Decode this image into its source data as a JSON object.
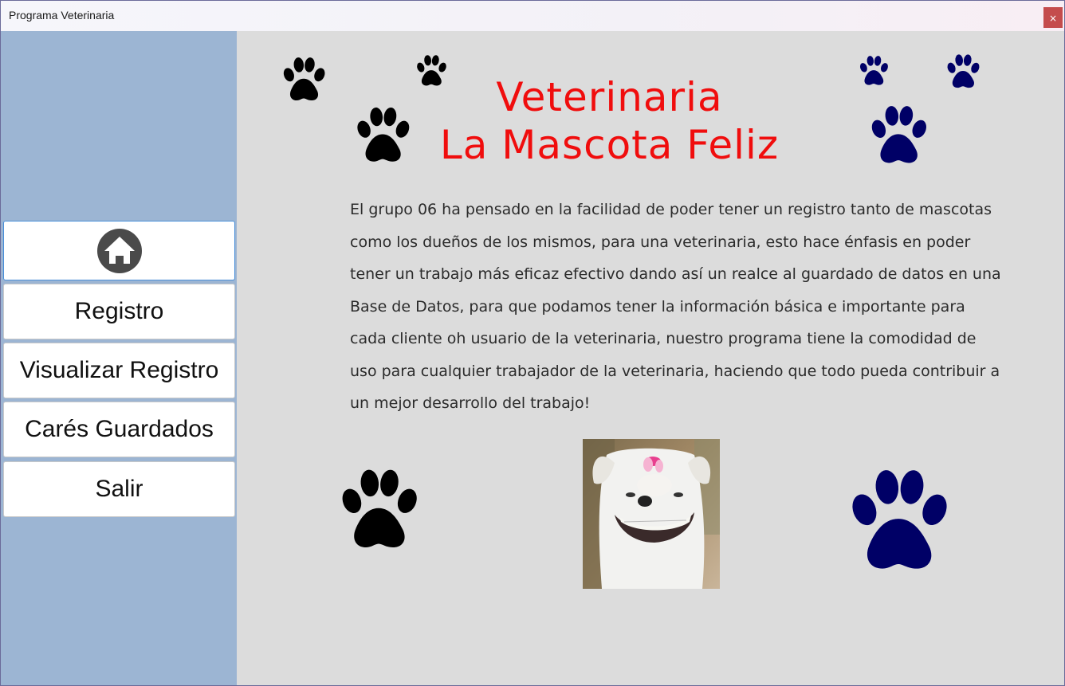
{
  "window": {
    "title": "Programa Veterinaria",
    "close_label": "×"
  },
  "sidebar": {
    "items": [
      {
        "label": "",
        "icon": "home-icon"
      },
      {
        "label": "Registro"
      },
      {
        "label": "Visualizar Registro"
      },
      {
        "label": "Carés Guardados"
      },
      {
        "label": "Salir"
      }
    ]
  },
  "main": {
    "title_line1": "Veterinaria",
    "title_line2": "La Mascota Feliz",
    "description": "El grupo 06 ha pensado en la facilidad de poder tener un registro tanto de mascotas como los dueños de los mismos, para una veterinaria, esto hace énfasis en poder tener un trabajo más eficaz  efectivo dando así un realce al guardado de datos en una Base de Datos, para que podamos tener la información básica e importante para cada cliente oh usuario de la veterinaria, nuestro programa tiene la comodidad de uso para cualquier trabajador de la veterinaria, haciendo que todo pueda contribuir a un mejor desarrollo del trabajo!"
  },
  "colors": {
    "title_red": "#f00d0d",
    "paw_black": "#000000",
    "paw_navy": "#000066",
    "sidebar_bg": "#9cb5d3",
    "content_bg": "#dcdcdc"
  }
}
